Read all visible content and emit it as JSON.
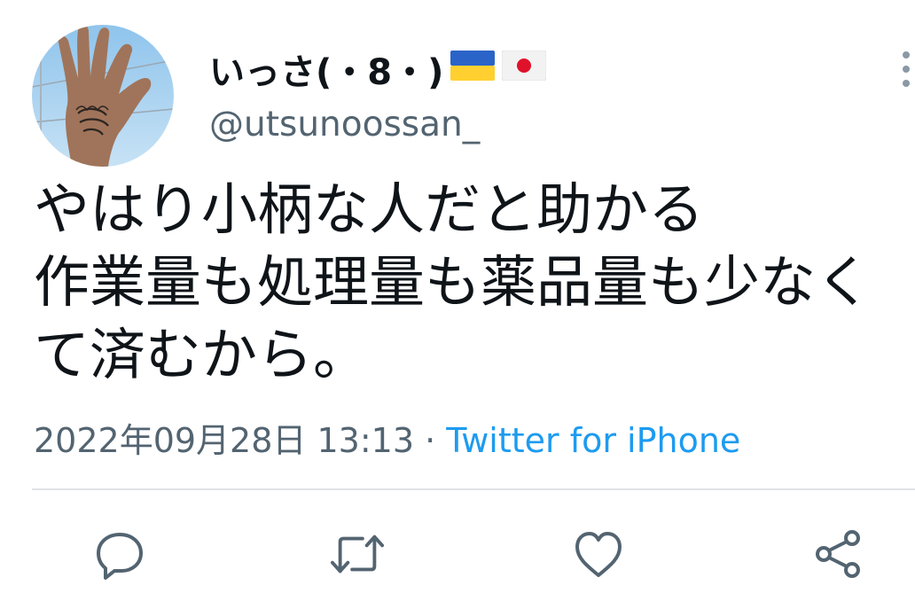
{
  "tweet": {
    "display_name": "いっさ(・8・)",
    "flags": [
      "ukraine-flag",
      "japan-flag"
    ],
    "handle": "@utsunoossan_",
    "body_lines": [
      "やはり小柄な人だと助かる",
      "作業量も処理量も薬品量も少なく",
      "て済むから。"
    ],
    "timestamp": "2022年09月28日 13:13",
    "separator": " · ",
    "source": "Twitter for iPhone"
  },
  "actions": [
    {
      "icon": "reply-icon"
    },
    {
      "icon": "retweet-icon"
    },
    {
      "icon": "like-icon"
    },
    {
      "icon": "share-icon"
    }
  ],
  "colors": {
    "text": "#0f1419",
    "secondary": "#536471",
    "link": "#1d9bf0",
    "divider": "#dfe3e6"
  }
}
